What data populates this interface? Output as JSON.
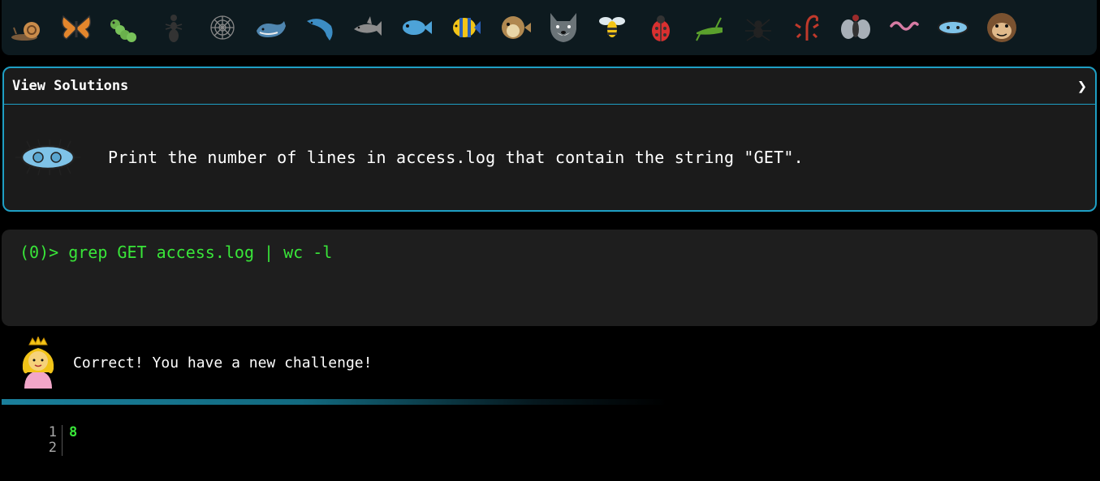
{
  "creatures": [
    {
      "name": "snail-icon"
    },
    {
      "name": "butterfly-icon"
    },
    {
      "name": "caterpillar-icon"
    },
    {
      "name": "ant-icon"
    },
    {
      "name": "spider-web-icon"
    },
    {
      "name": "whale-icon"
    },
    {
      "name": "dolphin-icon"
    },
    {
      "name": "shark-icon"
    },
    {
      "name": "fish-icon"
    },
    {
      "name": "tropical-fish-icon"
    },
    {
      "name": "pufferfish-icon"
    },
    {
      "name": "wolf-icon"
    },
    {
      "name": "bee-icon"
    },
    {
      "name": "ladybug-icon"
    },
    {
      "name": "cricket-icon"
    },
    {
      "name": "spider-icon"
    },
    {
      "name": "scorpion-icon"
    },
    {
      "name": "fly-icon"
    },
    {
      "name": "worm-icon"
    },
    {
      "name": "microbe-icon"
    },
    {
      "name": "monkey-icon"
    }
  ],
  "panel": {
    "title": "View Solutions",
    "toggle": "❯",
    "question": "Print the number of lines in access.log that contain the string \"GET\"."
  },
  "terminal": {
    "prompt": "(0)> ",
    "command": "grep GET access.log | wc -l"
  },
  "feedback": {
    "message": "Correct! You have a new challenge!"
  },
  "output": {
    "line_numbers": [
      "1",
      "2"
    ],
    "lines": [
      "8",
      ""
    ]
  },
  "colors": {
    "accent": "#1e9fc4",
    "terminal_green": "#39e639",
    "panel_bg": "#1b1b1b",
    "terminal_bg": "#1e1e1e"
  }
}
